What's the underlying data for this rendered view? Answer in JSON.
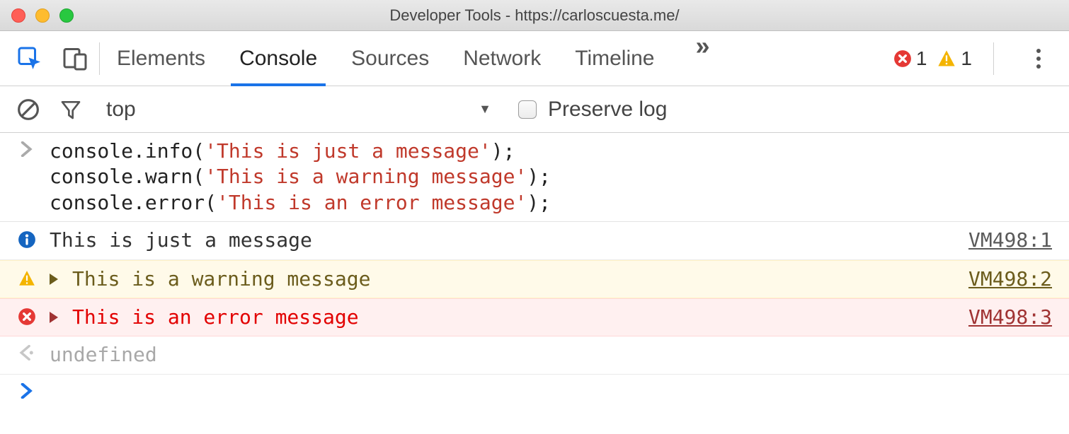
{
  "window": {
    "title": "Developer Tools - https://carloscuesta.me/"
  },
  "tabs": {
    "items": [
      "Elements",
      "Console",
      "Sources",
      "Network",
      "Timeline"
    ],
    "active": "Console",
    "more_label": "»"
  },
  "counters": {
    "errors": "1",
    "warnings": "1"
  },
  "filter": {
    "context": "top",
    "preserve_label": "Preserve log",
    "preserve_checked": false
  },
  "console": {
    "input_lines": [
      {
        "method": "console.info",
        "arg": "'This is just a message'"
      },
      {
        "method": "console.warn",
        "arg": "'This is a warning message'"
      },
      {
        "method": "console.error",
        "arg": "'This is an error message'"
      }
    ],
    "messages": [
      {
        "level": "info",
        "text": "This is just a message",
        "source": "VM498:1"
      },
      {
        "level": "warn",
        "text": "This is a warning message",
        "source": "VM498:2"
      },
      {
        "level": "error",
        "text": "This is an error message",
        "source": "VM498:3"
      }
    ],
    "return_value": "undefined"
  }
}
